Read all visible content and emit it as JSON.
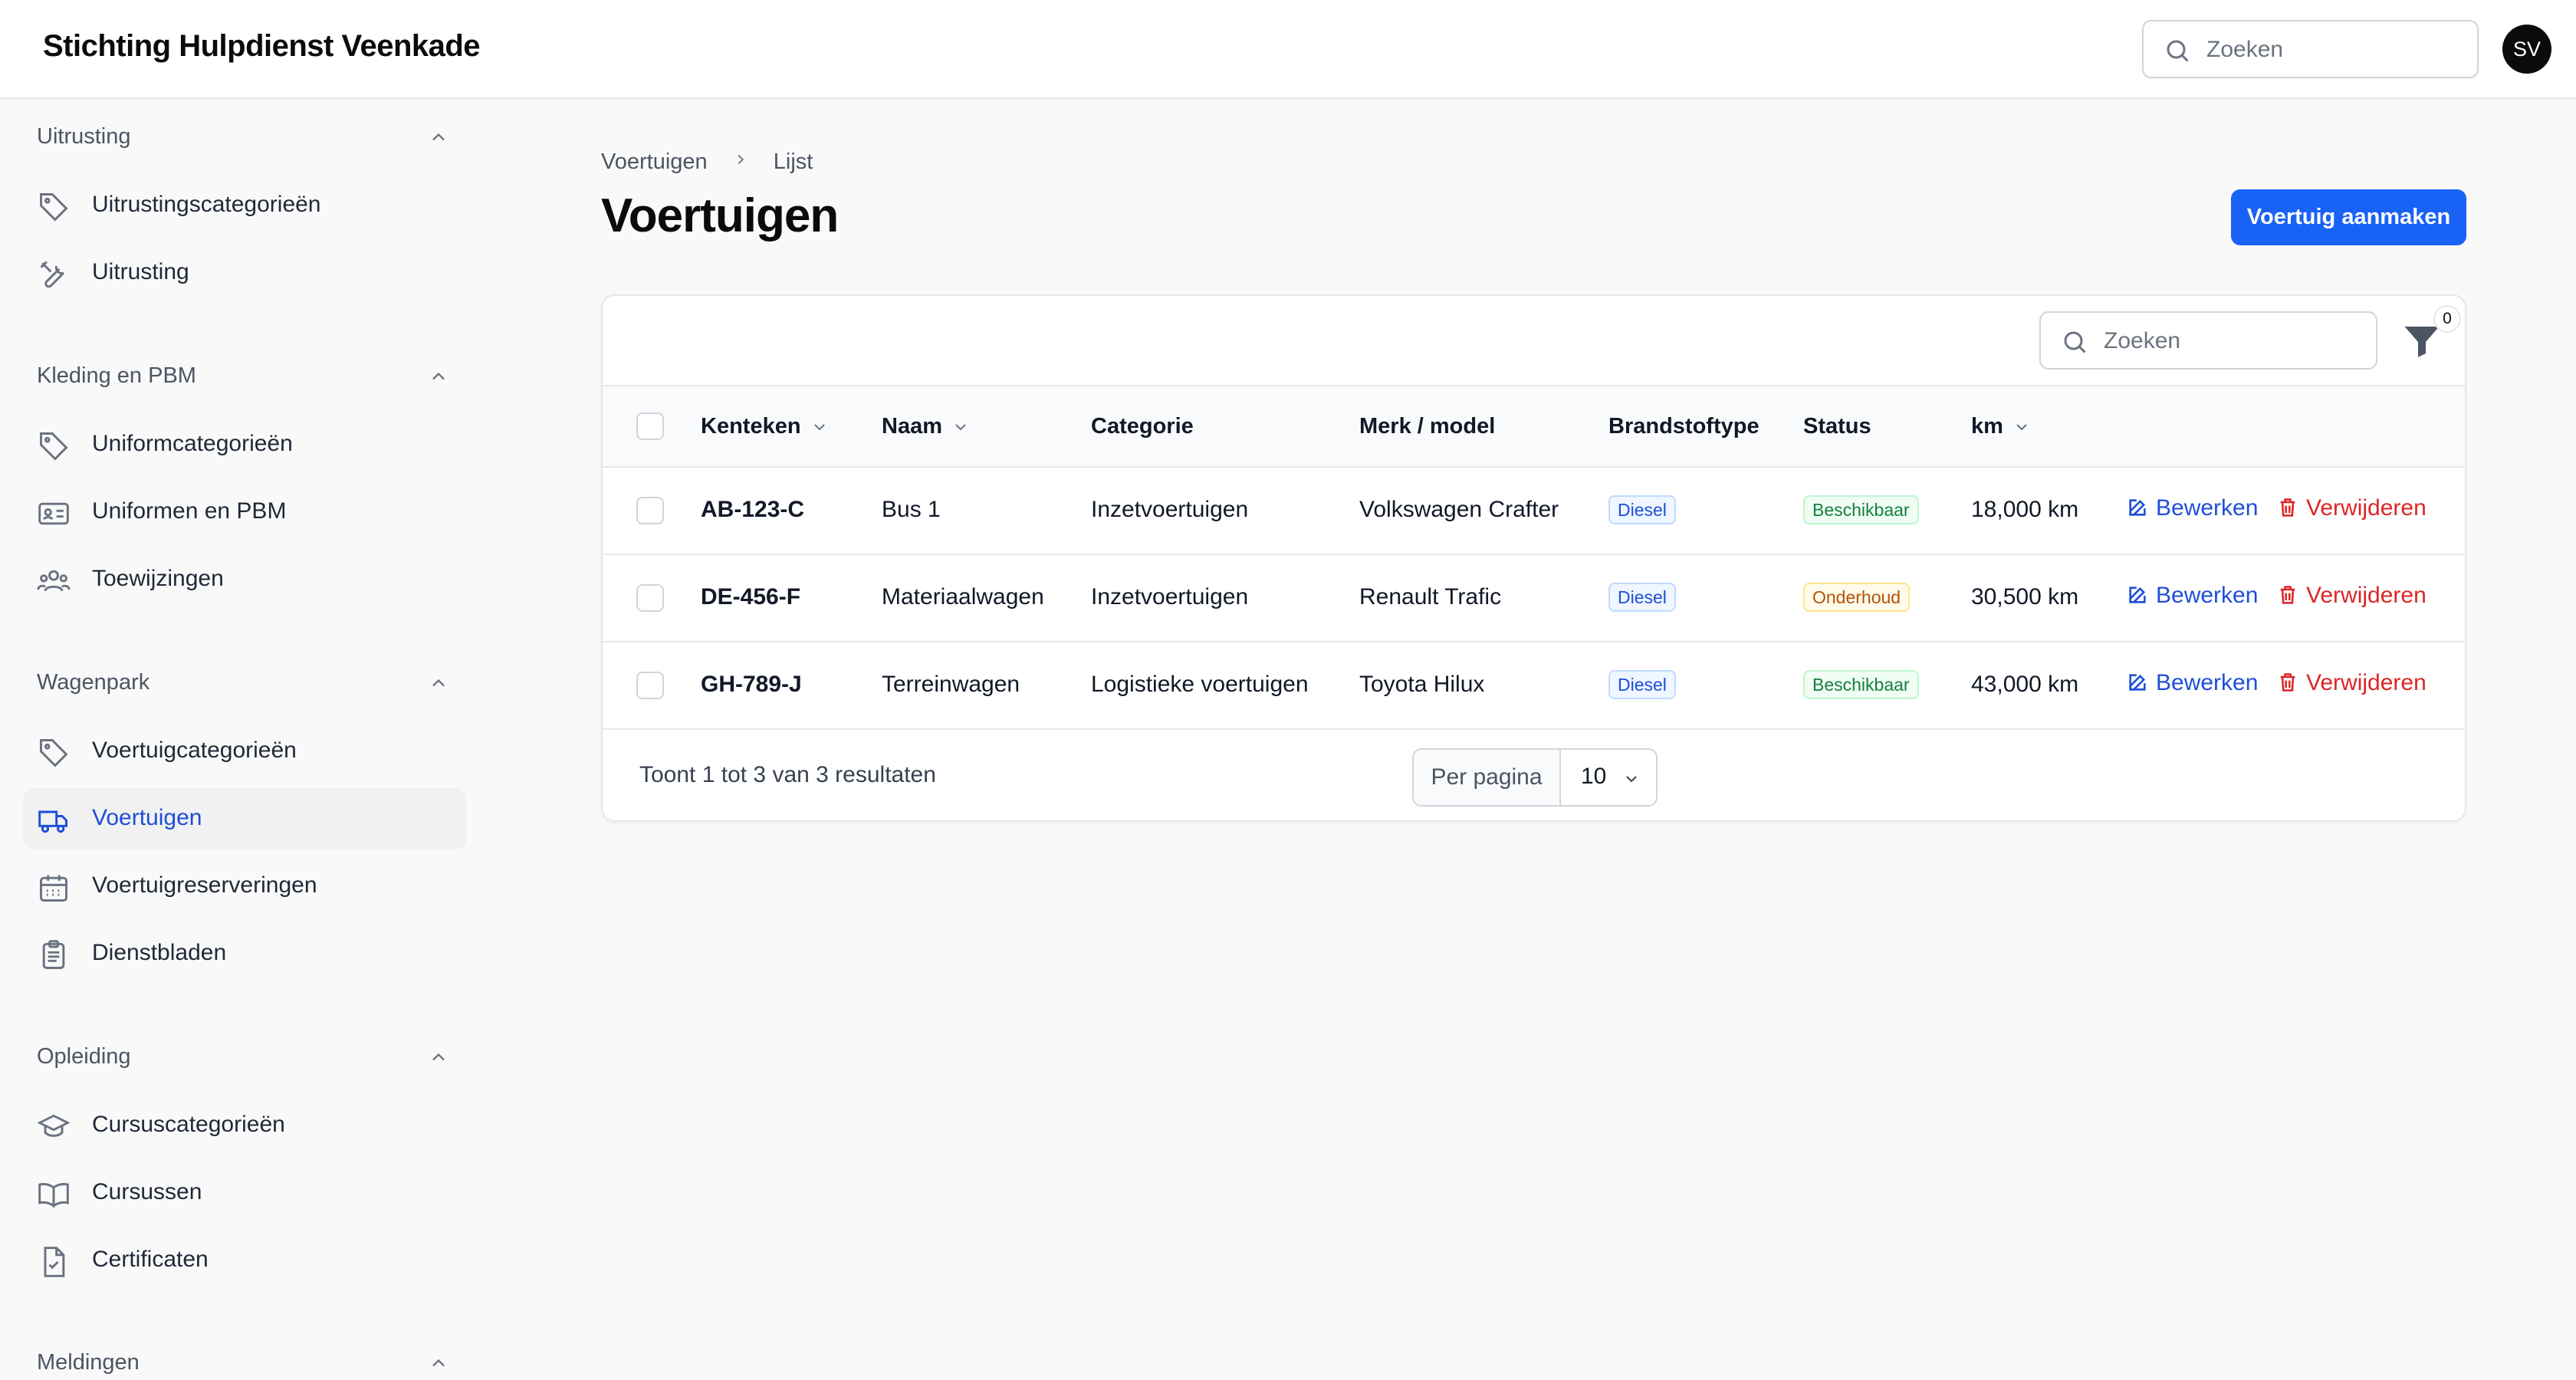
{
  "app": {
    "title": "Stichting Hulpdienst Veenkade",
    "search_placeholder": "Zoeken",
    "avatar_initials": "SV"
  },
  "sidebar": {
    "groups": [
      {
        "title": "Uitrusting",
        "items": [
          {
            "label": "Uitrustingscategorieën",
            "icon": "tag-icon"
          },
          {
            "label": "Uitrusting",
            "icon": "tools-icon"
          }
        ]
      },
      {
        "title": "Kleding en PBM",
        "items": [
          {
            "label": "Uniformcategorieën",
            "icon": "tag-icon"
          },
          {
            "label": "Uniformen en PBM",
            "icon": "id-card-icon"
          },
          {
            "label": "Toewijzingen",
            "icon": "users-icon"
          }
        ]
      },
      {
        "title": "Wagenpark",
        "items": [
          {
            "label": "Voertuigcategorieën",
            "icon": "tag-icon"
          },
          {
            "label": "Voertuigen",
            "icon": "truck-icon",
            "active": true
          },
          {
            "label": "Voertuigreserveringen",
            "icon": "calendar-icon"
          },
          {
            "label": "Dienstbladen",
            "icon": "clipboard-icon"
          }
        ]
      },
      {
        "title": "Opleiding",
        "items": [
          {
            "label": "Cursuscategorieën",
            "icon": "graduation-cap-icon"
          },
          {
            "label": "Cursussen",
            "icon": "book-icon"
          },
          {
            "label": "Certificaten",
            "icon": "document-check-icon"
          }
        ]
      },
      {
        "title": "Meldingen",
        "items": []
      }
    ]
  },
  "breadcrumb": {
    "parent": "Voertuigen",
    "current": "Lijst"
  },
  "page": {
    "title": "Voertuigen",
    "create_button": "Voertuig aanmaken"
  },
  "table": {
    "search_placeholder": "Zoeken",
    "filter_count": "0",
    "columns": [
      "Kenteken",
      "Naam",
      "Categorie",
      "Merk / model",
      "Brandstoftype",
      "Status",
      "km"
    ],
    "rows": [
      {
        "kenteken": "AB-123-C",
        "naam": "Bus 1",
        "categorie": "Inzetvoertuigen",
        "merk": "Volkswagen Crafter",
        "brandstof": "Diesel",
        "status": "Beschikbaar",
        "status_kind": "ok",
        "km": "18,000 km"
      },
      {
        "kenteken": "DE-456-F",
        "naam": "Materiaalwagen",
        "categorie": "Inzetvoertuigen",
        "merk": "Renault Trafic",
        "brandstof": "Diesel",
        "status": "Onderhoud",
        "status_kind": "warn",
        "km": "30,500 km"
      },
      {
        "kenteken": "GH-789-J",
        "naam": "Terreinwagen",
        "categorie": "Logistieke voertuigen",
        "merk": "Toyota Hilux",
        "brandstof": "Diesel",
        "status": "Beschikbaar",
        "status_kind": "ok",
        "km": "43,000 km"
      }
    ],
    "edit_label": "Bewerken",
    "delete_label": "Verwijderen",
    "footer": "Toont 1 tot 3 van 3 resultaten",
    "per_page_label": "Per pagina",
    "per_page_value": "10"
  },
  "colors": {
    "primary": "#1962f6",
    "danger": "#dc2626",
    "active_nav": "#1d4ed8"
  }
}
